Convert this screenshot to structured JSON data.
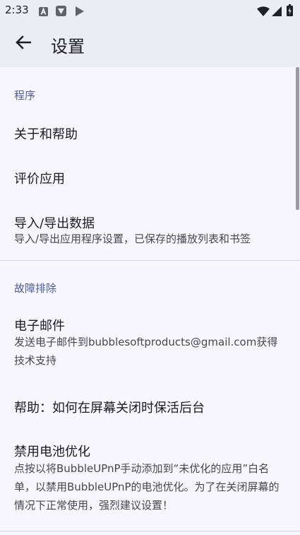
{
  "status_bar": {
    "time": "2:33"
  },
  "app_bar": {
    "title": "设置",
    "back_icon": "arrow-back-icon"
  },
  "sections": [
    {
      "header": "程序",
      "items": [
        {
          "title": "关于和帮助"
        },
        {
          "title": "评价应用"
        },
        {
          "title": "导入/导出数据",
          "summary": "导入/导出应用程序设置，已保存的播放列表和书签"
        }
      ]
    },
    {
      "header": "故障排除",
      "items": [
        {
          "title": "电子邮件",
          "summary": "发送电子邮件到bubblesoftproducts@gmail.com获得技术支持"
        },
        {
          "title": "帮助：如何在屏幕关闭时保活后台"
        },
        {
          "title": "禁用电池优化",
          "summary": "点按以将BubbleUPnP手动添加到“未优化的应用”白名单，以禁用BubbleUPnP的电池优化。为了在关闭屏幕的情况下正常使用，强烈建议设置！"
        }
      ]
    }
  ],
  "colors": {
    "accent": "#4e5a9c",
    "bar_background": "#ececf4",
    "page_background": "#f7f6fb"
  }
}
